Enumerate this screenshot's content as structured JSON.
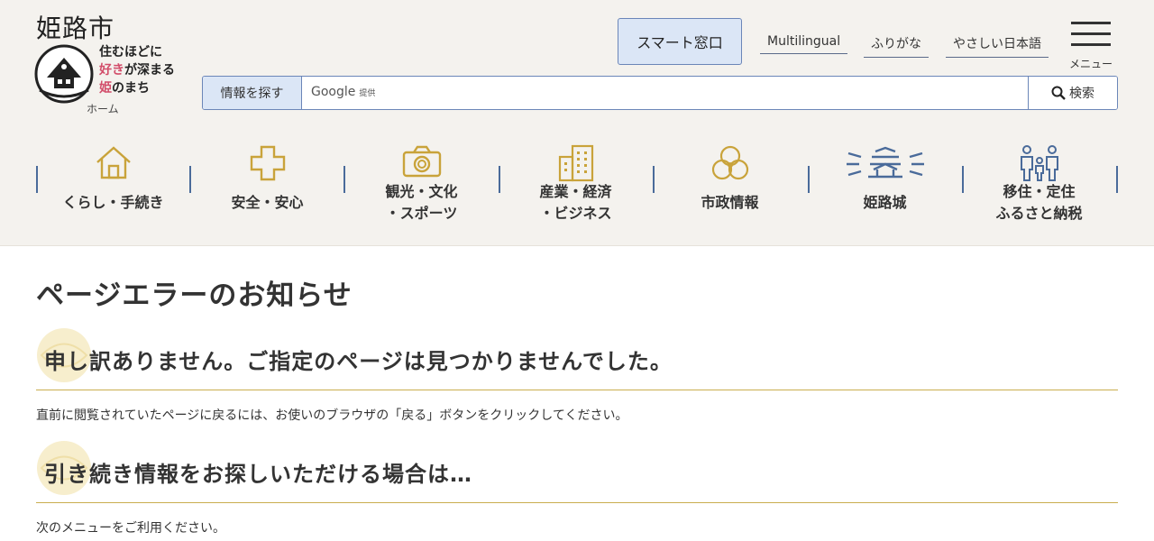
{
  "logo": {
    "city": "姫路市",
    "slogan_line1": "住むほどに",
    "slogan_line2a": "好き",
    "slogan_line2b": "が深まる",
    "slogan_line3a": "姫",
    "slogan_line3b": "のまち",
    "home_label": "ホーム"
  },
  "header": {
    "smart_window": "スマート窓口",
    "links": [
      "Multilingual",
      "ふりがな",
      "やさしい日本語"
    ],
    "menu_label": "メニュー"
  },
  "search": {
    "label": "情報を探す",
    "google": "Google",
    "google_suffix": "提供",
    "placeholder": "",
    "button": "検索"
  },
  "nav": [
    {
      "label": "くらし・手続き",
      "icon": "house-icon"
    },
    {
      "label": "安全・安心",
      "icon": "cross-icon"
    },
    {
      "label": "観光・文化\n・スポーツ",
      "icon": "camera-icon"
    },
    {
      "label": "産業・経済\n・ビジネス",
      "icon": "building-icon"
    },
    {
      "label": "市政情報",
      "icon": "emblem-icon"
    },
    {
      "label": "姫路城",
      "icon": "castle-icon"
    },
    {
      "label": "移住・定住\nふるさと納税",
      "icon": "family-icon"
    }
  ],
  "colors": {
    "accent_gold": "#c9a33a",
    "nav_blue": "#4a6b9a",
    "button_blue": "#dbe6f6"
  },
  "main": {
    "title": "ページエラーのお知らせ",
    "sections": [
      {
        "heading": "申し訳ありません。ご指定のページは見つかりませんでした。",
        "text": "直前に閲覧されていたページに戻るには、お使いのブラウザの「戻る」ボタンをクリックしてください。"
      },
      {
        "heading": "引き続き情報をお探しいただける場合は…",
        "text": "次のメニューをご利用ください。"
      }
    ]
  }
}
